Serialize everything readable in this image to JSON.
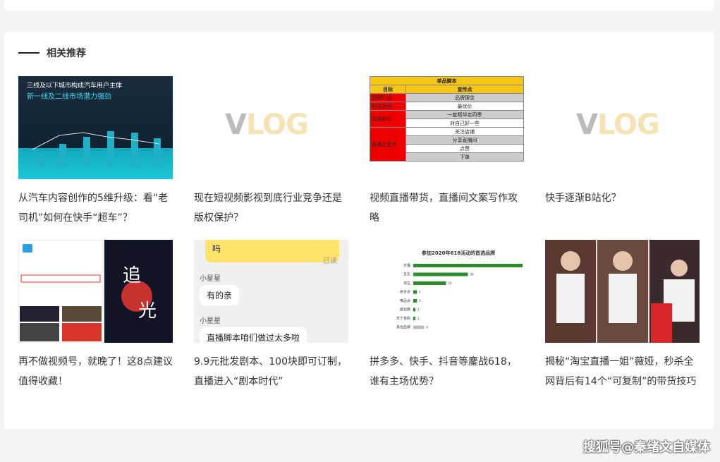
{
  "section": {
    "title": "相关推荐"
  },
  "cards": [
    {
      "caption": "从汽车内容创作的5维升级：看“老司机”如何在快手“超车”？",
      "thumb_line1": "三线及以下城市构成汽车用户主体",
      "thumb_line2": "新一线及二线市场潜力强劲"
    },
    {
      "caption": "现在短视频影视到底行业竞争还是版权保护？"
    },
    {
      "caption": "视频直播带货，直播间文案写作攻略",
      "table": {
        "title": "单品脚本",
        "headers": [
          "目标",
          "宣传点"
        ],
        "rows": [
          [
            "品牌介绍",
            "品牌理念"
          ],
          [
            "引流活动",
            "最优价"
          ],
          [
            "引导转化",
            "一套精华走四季"
          ],
          [
            "",
            "对自己好一些"
          ],
          [
            "直播注意点",
            "关注店铺"
          ],
          [
            "",
            "分享直播间"
          ],
          [
            "",
            "点赞"
          ],
          [
            "",
            "下单"
          ]
        ]
      }
    },
    {
      "caption": "快手逐渐B站化？"
    },
    {
      "caption": "再不做视频号，就晚了！这8点建议值得收藏！",
      "thumb_text": [
        "追",
        "光"
      ]
    },
    {
      "caption": "9.9元批发剧本、100块即可订制，直播进入“剧本时代”",
      "chat": {
        "top": "吗",
        "read": "已读",
        "name1": "小星星",
        "msg1": "有的亲",
        "name2": "小星星",
        "msg2": "直播脚本咱们做过太多啦"
      }
    },
    {
      "caption": "拼多多、快手、抖音等鏖战618，谁有主场优势？",
      "chart_title": "参加2020年618活动的首选品牌",
      "chart_data": {
        "type": "bar",
        "categories": [
          "天猫",
          "京东",
          "淘宝",
          "拼多多",
          "唯品会",
          "聚划算",
          "苏宁易购",
          "其他品牌"
        ],
        "values": [
          60,
          30,
          18,
          2,
          2,
          1,
          1,
          6
        ]
      }
    },
    {
      "caption": "揭秘“淘宝直播一姐”薇娅，秒杀全网背后有14个“可复制”的带货技巧"
    }
  ],
  "vlog": {
    "v": "V",
    "rest": "LOG"
  },
  "watermark": "搜狐号@秦绪文自媒体"
}
